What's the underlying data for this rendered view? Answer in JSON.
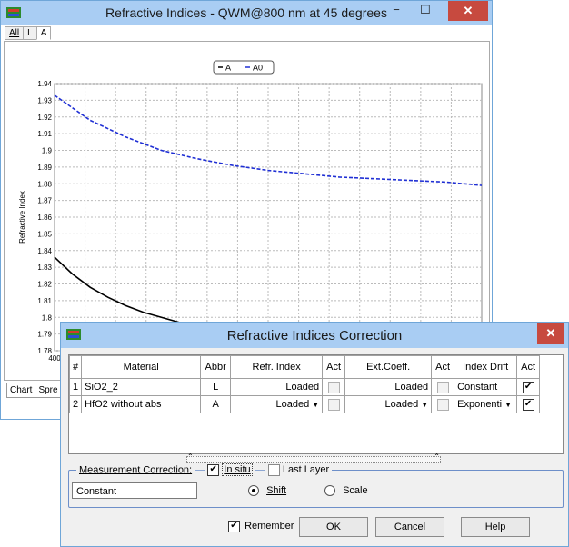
{
  "main_window": {
    "title": "Refractive Indices - QWM@800 nm at 45 degrees",
    "tabs": [
      "All",
      "L",
      "A"
    ],
    "bottom_tabs": [
      "Chart",
      "Spre"
    ],
    "minimize_glyph": "−",
    "maximize_glyph": "☐",
    "close_glyph": "✕"
  },
  "chart_data": {
    "type": "line",
    "ylabel": "Refractive Index",
    "xlabel": "",
    "ylim": [
      1.78,
      1.94
    ],
    "xlim": [
      400,
      1000
    ],
    "y_ticks": [
      "1.94",
      "1.93",
      "1.92",
      "1.91",
      "1.9",
      "1.89",
      "1.88",
      "1.87",
      "1.86",
      "1.85",
      "1.84",
      "1.83",
      "1.82",
      "1.81",
      "1.8",
      "1.79",
      "1.78"
    ],
    "x_ticks_visible": [
      "400"
    ],
    "grid": true,
    "legend": "top-center",
    "legend_entries": [
      "A",
      "A0"
    ],
    "series": [
      {
        "name": "A",
        "color": "#000000",
        "style": "solid",
        "x": [
          400,
          425,
          450,
          475,
          500,
          525,
          550,
          575,
          600,
          625,
          650
        ],
        "y": [
          1.836,
          1.826,
          1.818,
          1.812,
          1.807,
          1.803,
          1.8,
          1.797,
          1.795,
          1.793,
          1.791
        ]
      },
      {
        "name": "A0",
        "color": "#1f2fd4",
        "style": "dashed",
        "x": [
          400,
          450,
          500,
          550,
          600,
          650,
          700,
          750,
          800,
          850,
          900,
          950,
          1000
        ],
        "y": [
          1.933,
          1.918,
          1.908,
          1.9,
          1.895,
          1.891,
          1.888,
          1.886,
          1.884,
          1.883,
          1.882,
          1.881,
          1.879
        ]
      }
    ]
  },
  "dialog": {
    "title": "Refractive Indices Correction",
    "close_glyph": "✕",
    "columns": [
      "#",
      "Material",
      "Abbr",
      "Refr. Index",
      "Act",
      "Ext.Coeff.",
      "Act",
      "Index Drift",
      "Act"
    ],
    "rows": [
      {
        "num": "1",
        "material": "SiO2_2",
        "abbr": "L",
        "refr": "Loaded",
        "refr_dd": false,
        "act1": false,
        "ext": "Loaded",
        "ext_dd": false,
        "act2": false,
        "drift": "Constant",
        "drift_dd": false,
        "act3": true
      },
      {
        "num": "2",
        "material": "HfO2 without abs",
        "abbr": "A",
        "refr": "Loaded",
        "refr_dd": true,
        "act1": false,
        "ext": "Loaded",
        "ext_dd": true,
        "act2": false,
        "drift": "Exponenti",
        "drift_dd": true,
        "act3": true
      }
    ],
    "measurement_label": "Measurement Correction:",
    "in_situ_label": "In situ",
    "in_situ_checked": true,
    "last_layer_label": "Last Layer",
    "last_layer_checked": false,
    "constant_value": "Constant",
    "shift_label": "Shift",
    "scale_label": "Scale",
    "selected_mode": "Shift",
    "remember_label": "Remember",
    "remember_checked": true,
    "ok_label": "OK",
    "cancel_label": "Cancel",
    "help_label": "Help"
  }
}
